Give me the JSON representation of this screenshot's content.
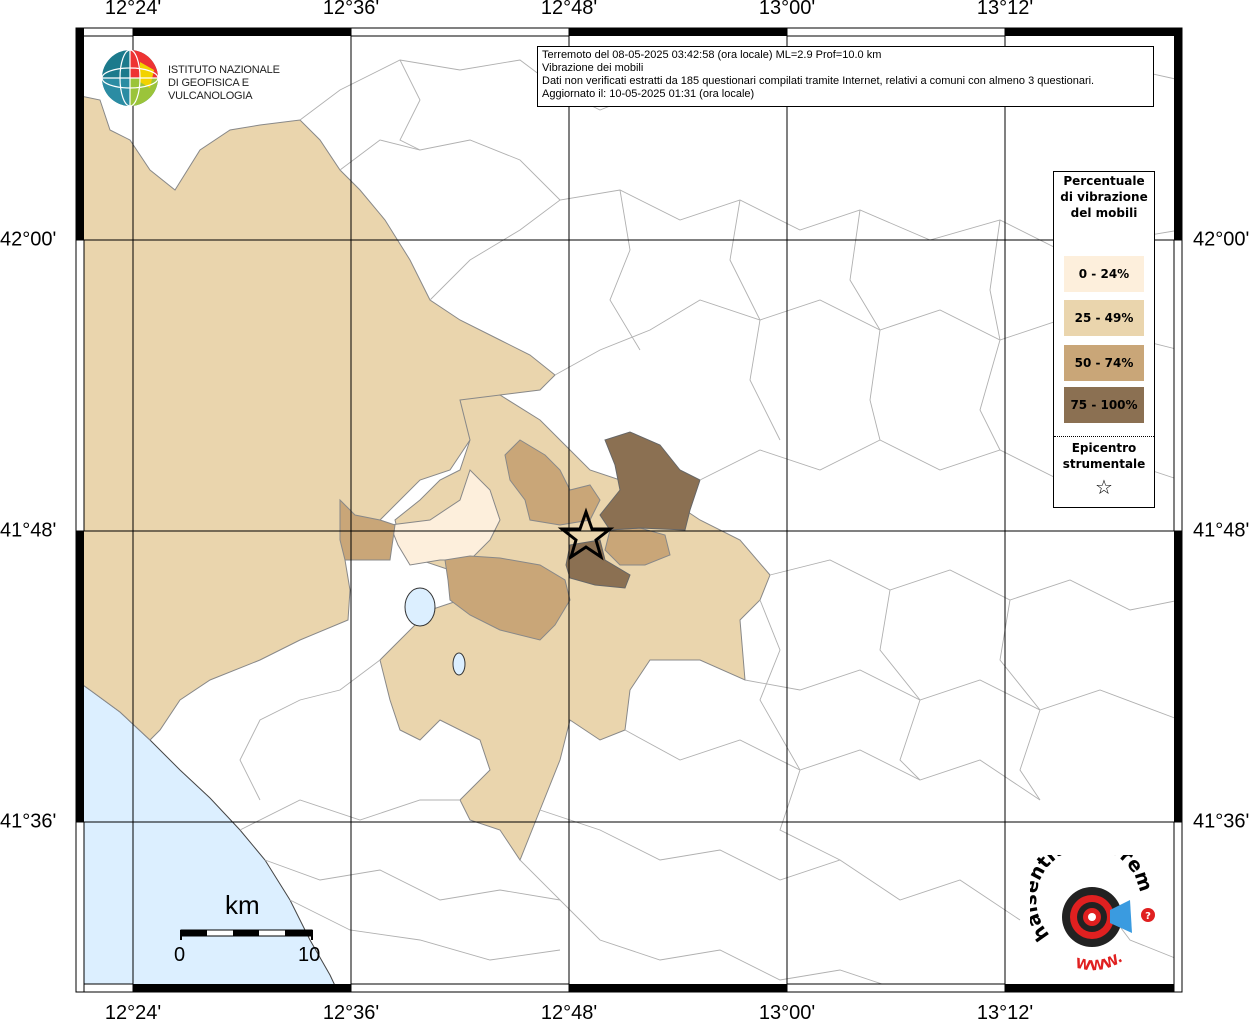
{
  "info": {
    "line1": "Terremoto del 08-05-2025 03:42:58 (ora locale) ML=2.9 Prof=10.0 km",
    "line2": "Vibrazione dei mobili",
    "line3": "Dati non verificati estratti da 185 questionari compilati tramite Internet, relativi a comuni con almeno 3 questionari.",
    "line4": "Aggiornato il: 10-05-2025 01:31 (ora locale)"
  },
  "logo": {
    "line1": "ISTITUTO NAZIONALE",
    "line2": "DI GEOFISICA E VULCANOLOGIA"
  },
  "axes": {
    "lon_ticks": [
      "12°24'",
      "12°36'",
      "12°48'",
      "13°00'",
      "13°12'"
    ],
    "lat_ticks": [
      "42°00'",
      "41°48'",
      "41°36'"
    ]
  },
  "legend": {
    "title": "Percentuale di vibrazione del mobili",
    "items": [
      {
        "label": "0 - 24%",
        "color": "#fdefdc"
      },
      {
        "label": "25 - 49%",
        "color": "#ead5ad"
      },
      {
        "label": "50 - 74%",
        "color": "#c9a678"
      },
      {
        "label": "75 - 100%",
        "color": "#8b7052"
      }
    ],
    "epicenter_label": "Epicentro strumentale",
    "epicenter_symbol": "☆"
  },
  "scale": {
    "unit": "km",
    "min": "0",
    "max": "10"
  },
  "colors": {
    "sea": "#dcefff",
    "land_empty": "#ffffff",
    "boundary": "#a0a0a0",
    "grid": "#000000"
  },
  "footer_logo": {
    "text_ring": "haisentitoilterremoto.it",
    "text_www": "WWW."
  }
}
